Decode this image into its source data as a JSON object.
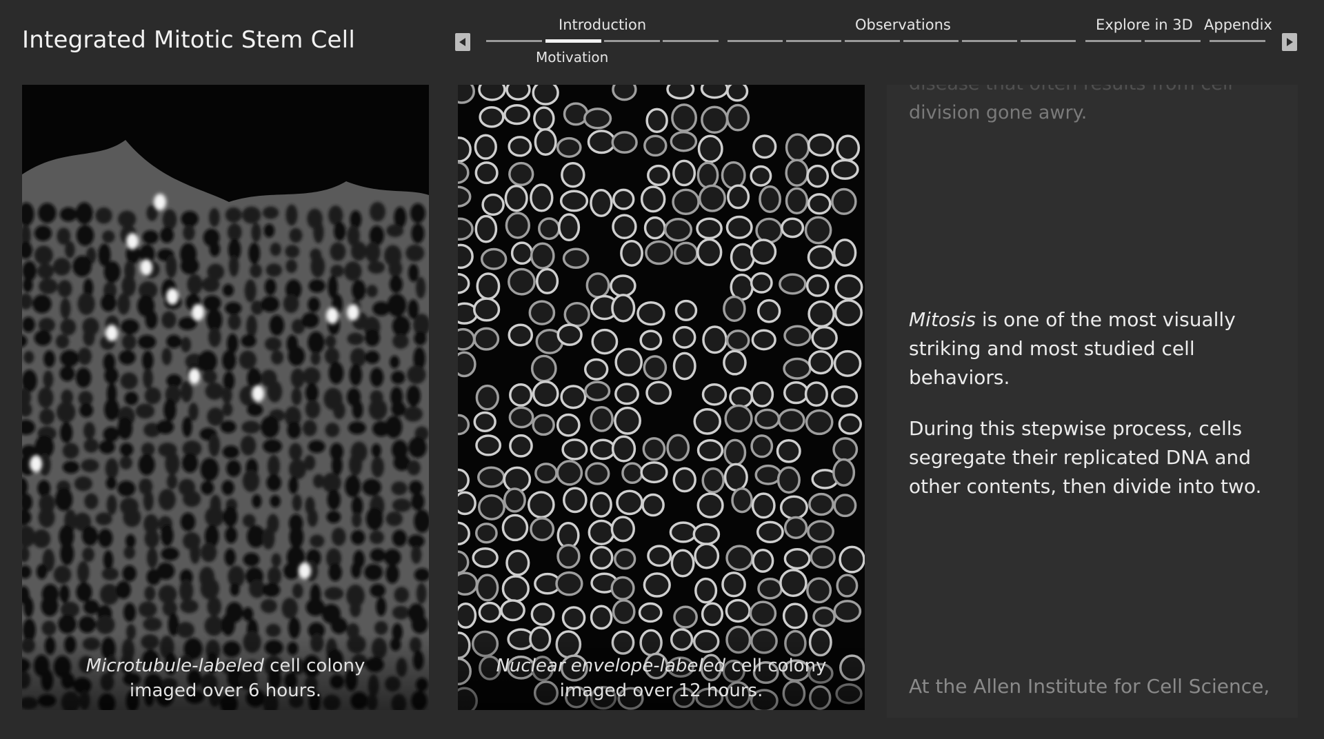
{
  "app": {
    "title": "Integrated Mitotic Stem Cell"
  },
  "nav": {
    "sections": [
      "Introduction",
      "Observations",
      "Explore in 3D",
      "Appendix"
    ],
    "current_subsection": "Motivation"
  },
  "panels": [
    {
      "caption_italic": "Microtubule-labeled",
      "caption_rest": " cell colony",
      "caption_line2": "imaged over 6 hours."
    },
    {
      "caption_italic": "Nuclear envelope-labeled",
      "caption_rest": " cell colony",
      "caption_line2": "imaged over 12 hours."
    }
  ],
  "text": {
    "faded_top_line1": "disease that often results from cell",
    "faded_top_line2": "division gone awry.",
    "p1_italic": "Mitosis",
    "p1_rest": " is one of the most visually striking and most studied cell behaviors.",
    "p2": "During this stepwise process, cells segregate their replicated DNA and other contents, then divide into two.",
    "faded_bottom": "At the Allen Institute for Cell Science,"
  },
  "colors": {
    "background": "#2b2b2b",
    "text_panel": "#2f2f2f",
    "accent": "#f2f2f2"
  }
}
